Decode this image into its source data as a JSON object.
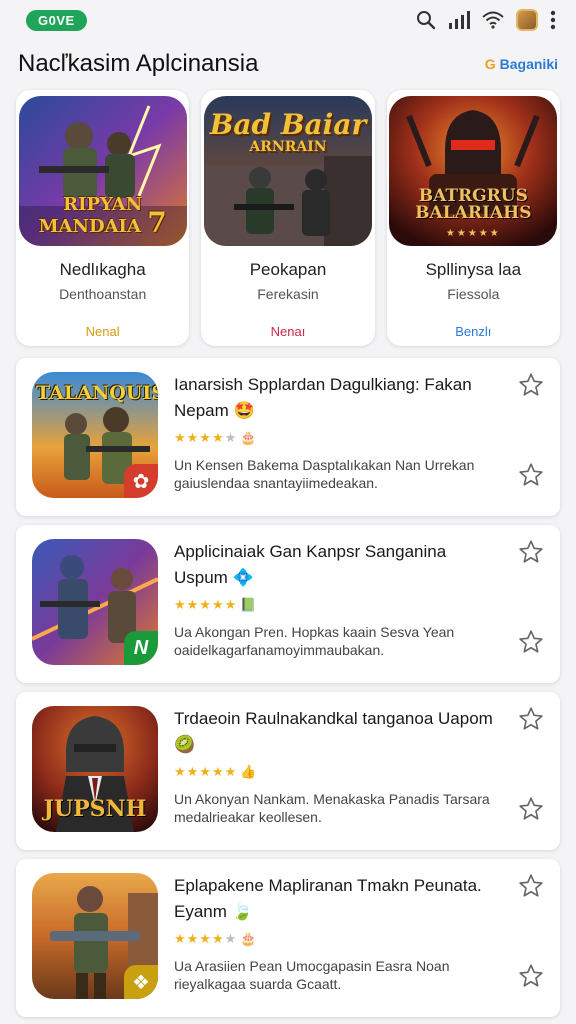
{
  "status_bar": {
    "brand": "G0VE"
  },
  "header": {
    "title": "Nacľkasim Aplcinansia",
    "link": "Baganiki"
  },
  "featured": [
    {
      "art_text": "RIPYAN MANDAIA",
      "art_num": "7",
      "title": "Nedlıkagha",
      "subtitle": "Denthoanstan",
      "badge": "Nenal",
      "badge_color": "#d89a10"
    },
    {
      "art_text": "Bad Baiar",
      "art_sub": "ARNRAIN",
      "title": "Peokapan",
      "subtitle": "Ferekasin",
      "badge": "Nenaı",
      "badge_color": "#d0264a"
    },
    {
      "art_text": "BATRGRUS BALARIAHS",
      "title": "Spllinysa laa",
      "subtitle": "Fiessola",
      "badge": "Benzlı",
      "badge_color": "#2a7bd6"
    }
  ],
  "apps": [
    {
      "icon_text": "TALANQUIS",
      "title": "Ianarsish Spplardan Dagulkiang: Fakan Nepam 🤩",
      "desc": "Un Kensen Bakema Dasptalıkakan Nan Urrekan gaiuslendaa snantayiimedeakan.",
      "rating_emoji": "🎂",
      "badge_color": "#d43c2c",
      "badge_glyph": "✿"
    },
    {
      "icon_text": "",
      "title": "Applicinaiak Gan Kanpsr Sanganina Uspum 💠",
      "desc": "Ua Akongan Pren. Hopkas kaain Sesva Yean oaidelkagarfanamoyimmaubakan.",
      "rating_emoji": "📗",
      "badge_color": "#1a9a3a",
      "badge_glyph": "N"
    },
    {
      "icon_text": "JUPSNH",
      "title": "Trdaeoin Raulnakandkal tanganoa Uapom 🥝",
      "desc": "Un Akonyan Nankam. Menakaska Panadis Tarsara medalrieakar keollesen.",
      "rating_emoji": "👍",
      "badge_color": "",
      "badge_glyph": ""
    },
    {
      "icon_text": "",
      "title": "Eplapakene Mapliranan Tmakn Peunata. Eyanm 🍃",
      "desc": "Ua Arasiien Pean Umocgapasin Easra Noan rieyalkagaa suarda Gcaatt.",
      "rating_emoji": "🎂",
      "badge_color": "#c8a010",
      "badge_glyph": "❖"
    }
  ]
}
